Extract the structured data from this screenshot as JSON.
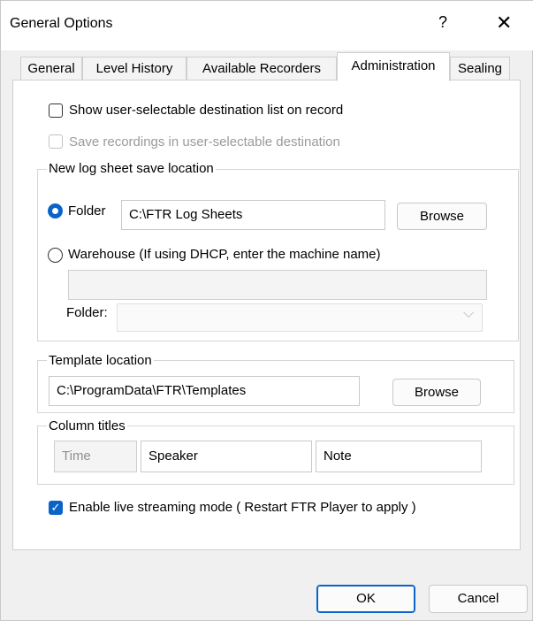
{
  "window": {
    "title": "General Options",
    "help": "?",
    "close": "✕"
  },
  "tabs": [
    {
      "label": "General"
    },
    {
      "label": "Level History"
    },
    {
      "label": "Available Recorders"
    },
    {
      "label": "Administration"
    },
    {
      "label": "Sealing"
    }
  ],
  "active_tab": "Administration",
  "options": {
    "show_list": {
      "label": "Show user-selectable destination list on record",
      "checked": false
    },
    "save_recordings": {
      "label": "Save recordings in user-selectable destination",
      "checked": false,
      "enabled": false
    }
  },
  "log_sheet": {
    "legend": "New log sheet save location",
    "folder_label": "Folder",
    "folder_value": "C:\\FTR Log Sheets",
    "browse": "Browse",
    "warehouse_label": "Warehouse (If using DHCP, enter the machine name)",
    "warehouse_value": "",
    "sub_folder_label": "Folder:",
    "sub_folder_value": "",
    "selected": "folder"
  },
  "template": {
    "legend": "Template location",
    "value": "C:\\ProgramData\\FTR\\Templates",
    "browse": "Browse"
  },
  "columns": {
    "legend": "Column titles",
    "time": "Time",
    "speaker": "Speaker",
    "note": "Note"
  },
  "streaming": {
    "label": "Enable live streaming mode ( Restart FTR Player to apply )",
    "checked": true
  },
  "footer": {
    "ok": "OK",
    "cancel": "Cancel"
  },
  "icons": {
    "check": "✓",
    "chevron": "⌵"
  },
  "colors": {
    "accent": "#0a63c9"
  }
}
